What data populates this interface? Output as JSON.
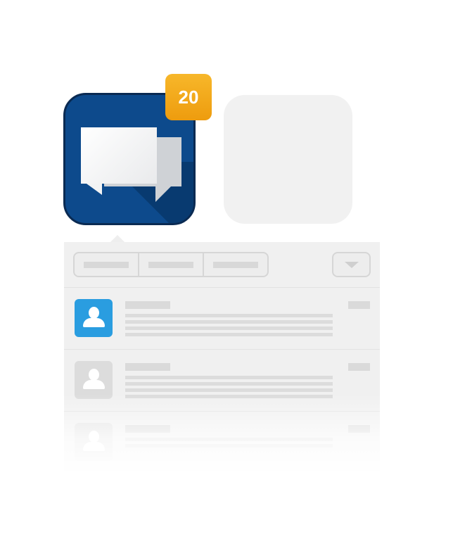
{
  "app": {
    "icon_name": "chat-bubbles-icon",
    "icon_color": "#0d4a8c",
    "badge_count": "20",
    "badge_color": "#f2a81c"
  },
  "placeholder_app": {
    "color": "#f1f1f1"
  },
  "panel": {
    "toolbar": {
      "segments": [
        "",
        "",
        ""
      ],
      "dropdown_icon": "chevron-down-icon"
    },
    "rows": [
      {
        "avatar_icon": "contact-icon",
        "avatar_color": "#2a9de0",
        "active": true
      },
      {
        "avatar_icon": "contact-icon",
        "avatar_color": "#dcdcdc",
        "active": false
      },
      {
        "avatar_icon": "contact-icon",
        "avatar_color": "#e2e2e2",
        "active": false
      }
    ]
  }
}
